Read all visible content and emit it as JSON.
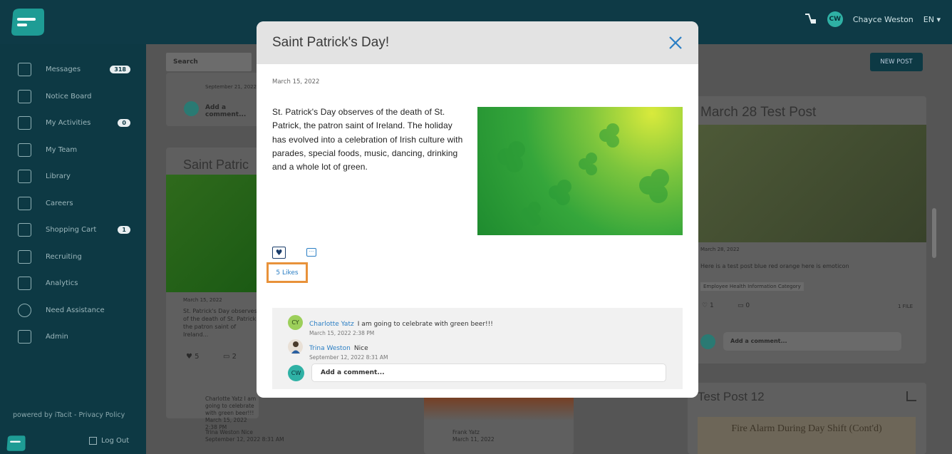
{
  "user": {
    "initials": "CW",
    "name": "Chayce Weston",
    "language": "EN"
  },
  "sidebar": {
    "items": [
      {
        "label": "Messages",
        "badge": "318",
        "icon": "messages-icon"
      },
      {
        "label": "Notice Board",
        "badge": "",
        "icon": "notice-board-icon"
      },
      {
        "label": "My Activities",
        "badge": "0",
        "icon": "activities-icon"
      },
      {
        "label": "My Team",
        "badge": "",
        "icon": "team-icon"
      },
      {
        "label": "Library",
        "badge": "",
        "icon": "library-icon"
      },
      {
        "label": "Careers",
        "badge": "",
        "icon": "careers-icon"
      },
      {
        "label": "Shopping Cart",
        "badge": "1",
        "icon": "cart-icon"
      },
      {
        "label": "Recruiting",
        "badge": "",
        "icon": "recruiting-icon"
      },
      {
        "label": "Analytics",
        "badge": "",
        "icon": "analytics-icon"
      },
      {
        "label": "Need Assistance",
        "badge": "",
        "icon": "help-icon"
      },
      {
        "label": "Admin",
        "badge": "",
        "icon": "admin-icon"
      }
    ],
    "powered_by": "powered by iTacit - Privacy Policy",
    "logout": "Log Out"
  },
  "feed": {
    "search_placeholder": "Search",
    "new_post": "NEW POST",
    "left_top_date": "September 21, 2022",
    "left_add_comment": "Add a comment...",
    "card_saint_title": "Saint Patric",
    "card_saint_date": "March 15, 2022",
    "card_saint_text": "St. Patrick's Day observes of the death of St. Patrick, the patron saint of Ireland...",
    "card_saint_likes": "5",
    "card_saint_comments": "2",
    "card_saint_comment1_name": "Charlotte Yatz",
    "card_saint_comment1_text": "I am going to celebrate with green beer!!!",
    "card_saint_comment1_time": "March 15, 2022 2:38 PM",
    "card_saint_comment2_name": "Trina Weston",
    "card_saint_comment2_text": "Nice",
    "card_saint_comment2_time": "September 12, 2022 8:31 AM",
    "mid_author": "Frank Yatz",
    "mid_date": "March 11, 2022",
    "card_march_title": "March 28 Test Post",
    "card_march_date": "March 28, 2022",
    "card_march_text": "Here is a test post blue red orange here is emoticon",
    "card_march_category": "Employee Health Information Category",
    "card_march_likes": "1",
    "card_march_comments": "0",
    "card_march_files": "1 FILE",
    "card_march_add_comment": "Add a comment...",
    "card_test_title": "Test Post 12",
    "card_test_preview": "Fire Alarm During Day Shift (Cont'd)"
  },
  "modal": {
    "title": "Saint Patrick's Day!",
    "date": "March 15, 2022",
    "body": "St. Patrick's Day observes of the death of St. Patrick, the patron saint of Ireland. The holiday has evolved into a celebration of Irish culture with parades, special foods, music, dancing, drinking and a whole lot of green.",
    "likes_label": "5 Likes",
    "comments": [
      {
        "initials": "CY",
        "name": "Charlotte Yatz",
        "text": "I am going to celebrate with green beer!!!",
        "time": "March 15, 2022 2:38 PM"
      },
      {
        "initials": "",
        "name": "Trina Weston",
        "text": "Nice",
        "time": "September 12, 2022 8:31 AM"
      }
    ],
    "add_comment_placeholder": "Add a comment...",
    "current_user_initials": "CW"
  },
  "colors": {
    "sidebar": "#0d3944",
    "accent": "#2a7ec4",
    "highlight": "#e8923a",
    "avatar": "#2fb1a5"
  }
}
